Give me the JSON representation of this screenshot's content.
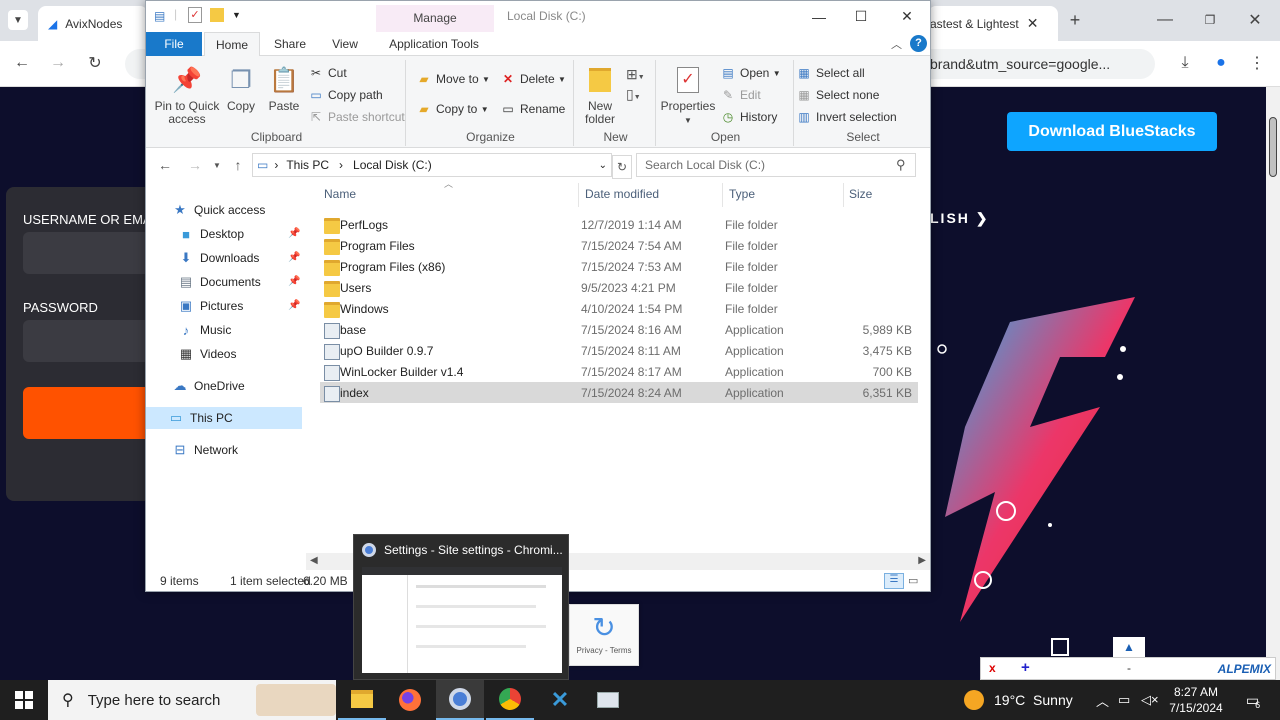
{
  "browser": {
    "tabs": [
      {
        "label": "AvixNodes"
      },
      {
        "label": "astest & Lightest"
      }
    ],
    "url": "brand&utm_source=google...",
    "page": {
      "username_label": "USERNAME OR EMAI",
      "password_label": "PASSWORD",
      "language": "LISH",
      "download_button": "Download BlueStacks",
      "recaptcha_text": "Privacy - Terms",
      "alpemix_brand": "ALPEMIX"
    }
  },
  "explorer": {
    "manage_tab": "Manage",
    "window_title": "Local Disk (C:)",
    "tabs": [
      "File",
      "Home",
      "Share",
      "View",
      "Application Tools"
    ],
    "ribbon": {
      "clipboard": {
        "label": "Clipboard",
        "pin": "Pin to Quick access",
        "copy": "Copy",
        "paste": "Paste",
        "cut": "Cut",
        "copy_path": "Copy path",
        "paste_shortcut": "Paste shortcut"
      },
      "organize": {
        "label": "Organize",
        "move_to": "Move to",
        "copy_to": "Copy to",
        "delete": "Delete",
        "rename": "Rename"
      },
      "new": {
        "label": "New",
        "new_folder": "New folder"
      },
      "open": {
        "label": "Open",
        "properties": "Properties",
        "open": "Open",
        "edit": "Edit",
        "history": "History"
      },
      "select": {
        "label": "Select",
        "select_all": "Select all",
        "select_none": "Select none",
        "invert": "Invert selection"
      }
    },
    "address": {
      "root": "This PC",
      "current": "Local Disk (C:)"
    },
    "search_placeholder": "Search Local Disk (C:)",
    "nav": {
      "quick_access": "Quick access",
      "desktop": "Desktop",
      "downloads": "Downloads",
      "documents": "Documents",
      "pictures": "Pictures",
      "music": "Music",
      "videos": "Videos",
      "onedrive": "OneDrive",
      "this_pc": "This PC",
      "network": "Network"
    },
    "columns": {
      "name": "Name",
      "date": "Date modified",
      "type": "Type",
      "size": "Size"
    },
    "files": [
      {
        "name": "PerfLogs",
        "date": "12/7/2019 1:14 AM",
        "type": "File folder",
        "size": "",
        "kind": "folder"
      },
      {
        "name": "Program Files",
        "date": "7/15/2024 7:54 AM",
        "type": "File folder",
        "size": "",
        "kind": "folder"
      },
      {
        "name": "Program Files (x86)",
        "date": "7/15/2024 7:53 AM",
        "type": "File folder",
        "size": "",
        "kind": "folder"
      },
      {
        "name": "Users",
        "date": "9/5/2023 4:21 PM",
        "type": "File folder",
        "size": "",
        "kind": "folder"
      },
      {
        "name": "Windows",
        "date": "4/10/2024 1:54 PM",
        "type": "File folder",
        "size": "",
        "kind": "folder"
      },
      {
        "name": "base",
        "date": "7/15/2024 8:16 AM",
        "type": "Application",
        "size": "5,989 KB",
        "kind": "app"
      },
      {
        "name": "upO Builder 0.9.7",
        "date": "7/15/2024 8:11 AM",
        "type": "Application",
        "size": "3,475 KB",
        "kind": "app"
      },
      {
        "name": "WinLocker Builder v1.4",
        "date": "7/15/2024 8:17 AM",
        "type": "Application",
        "size": "700 KB",
        "kind": "app"
      },
      {
        "name": "index",
        "date": "7/15/2024 8:24 AM",
        "type": "Application",
        "size": "6,351 KB",
        "kind": "app",
        "selected": true
      }
    ],
    "status": {
      "items": "9 items",
      "selected": "1 item selected",
      "size": "6.20 MB"
    }
  },
  "thumbnail": {
    "title": "Settings - Site settings - Chromi..."
  },
  "taskbar": {
    "search_placeholder": "Type here to search",
    "weather": "19°C  Sunny",
    "time": "8:27 AM",
    "date": "7/15/2024",
    "notifications": "6"
  },
  "colors": {
    "accent": "#1979ca",
    "selection": "#cce8ff",
    "bluestacks": "#0ea5ff",
    "login_button": "#ff5200"
  }
}
